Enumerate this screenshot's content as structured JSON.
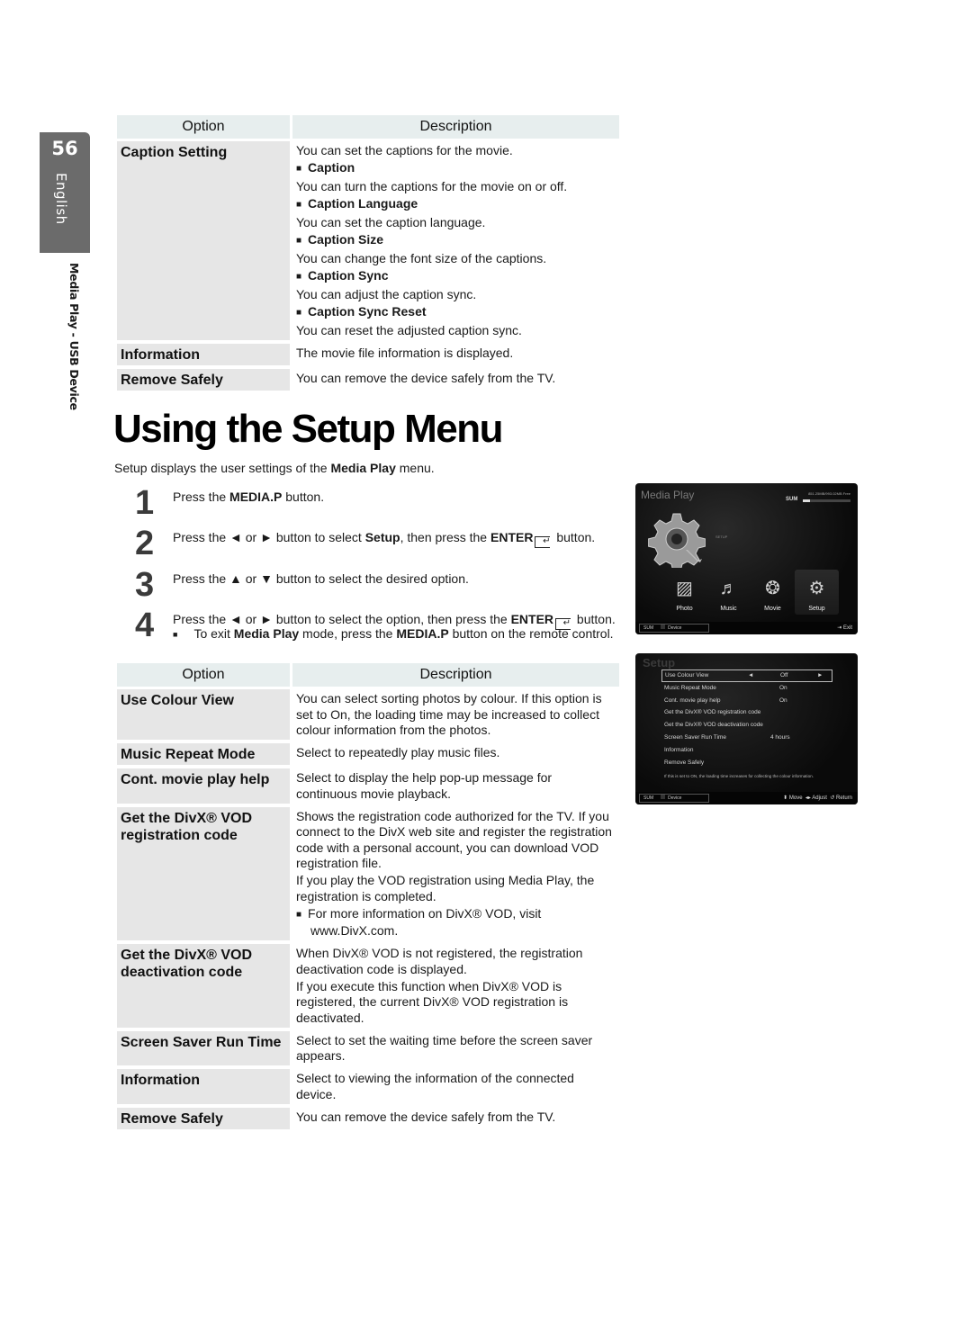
{
  "sidebar": {
    "page_number": "56",
    "language": "English",
    "section": "Media Play - USB Device"
  },
  "table1": {
    "header": {
      "option": "Option",
      "description": "Description"
    },
    "rows": [
      {
        "option": "Caption Setting",
        "lines": [
          {
            "type": "text",
            "text": "You can set the captions for the movie."
          },
          {
            "type": "sub",
            "text": "Caption"
          },
          {
            "type": "text",
            "text": "You can turn the captions for the movie on or off."
          },
          {
            "type": "sub",
            "text": "Caption Language"
          },
          {
            "type": "text",
            "text": "You can set the caption language."
          },
          {
            "type": "sub",
            "text": "Caption Size"
          },
          {
            "type": "text",
            "text": "You can change the font size of the captions."
          },
          {
            "type": "sub",
            "text": "Caption Sync"
          },
          {
            "type": "text",
            "text": "You can adjust the caption sync."
          },
          {
            "type": "sub",
            "text": "Caption Sync Reset"
          },
          {
            "type": "text",
            "text": "You can reset the adjusted caption sync."
          }
        ]
      },
      {
        "option": "Information",
        "lines": [
          {
            "type": "text",
            "text": "The movie file information is displayed."
          }
        ]
      },
      {
        "option": "Remove Safely",
        "lines": [
          {
            "type": "text",
            "text": "You can remove the device safely from the TV."
          }
        ]
      }
    ]
  },
  "heading": {
    "title": "Using the Setup Menu",
    "intro_pre": "Setup displays the user settings of the ",
    "intro_bold": "Media Play",
    "intro_post": " menu."
  },
  "steps": [
    {
      "num": "1",
      "parts": [
        [
          "t",
          "Press the "
        ],
        [
          "b",
          "MEDIA.P"
        ],
        [
          "t",
          " button."
        ]
      ]
    },
    {
      "num": "2",
      "parts": [
        [
          "t",
          "Press the ◄ or ► button to select "
        ],
        [
          "b",
          "Setup"
        ],
        [
          "t",
          ", then press the "
        ],
        [
          "b",
          "ENTER"
        ],
        [
          "i",
          ""
        ],
        [
          "t",
          " button."
        ]
      ]
    },
    {
      "num": "3",
      "parts": [
        [
          "t",
          "Press the ▲ or ▼ button to select the desired option."
        ]
      ]
    },
    {
      "num": "4",
      "parts": [
        [
          "t",
          "Press the ◄ or ► button to select the option, then press the "
        ],
        [
          "b",
          "ENTER"
        ],
        [
          "i",
          ""
        ],
        [
          "t",
          " button."
        ]
      ],
      "note": [
        [
          "t",
          "To exit "
        ],
        [
          "b",
          "Media Play"
        ],
        [
          "t",
          " mode, press the "
        ],
        [
          "b",
          "MEDIA.P"
        ],
        [
          "t",
          " button on the remote control."
        ]
      ]
    }
  ],
  "table2": {
    "header": {
      "option": "Option",
      "description": "Description"
    },
    "rows": [
      {
        "option": "Use Colour View",
        "lines": [
          {
            "type": "text",
            "text": "You can select sorting photos by colour. If this option is set to On, the loading time may be increased to collect colour information from the photos."
          }
        ]
      },
      {
        "option": "Music Repeat Mode",
        "lines": [
          {
            "type": "text",
            "text": "Select to repeatedly play music files."
          }
        ]
      },
      {
        "option": "Cont. movie play help",
        "lines": [
          {
            "type": "text",
            "text": "Select to display the help pop-up message for continuous movie playback."
          }
        ]
      },
      {
        "option": "Get the DivX® VOD registration code",
        "lines": [
          {
            "type": "text",
            "text": "Shows the registration code authorized for the TV. If you connect to the DivX web site and register the registration code with a personal account, you can download VOD registration file."
          },
          {
            "type": "text",
            "text": "If you play the VOD registration using Media Play, the registration is completed."
          },
          {
            "type": "note",
            "text": "For more information on DivX® VOD, visit www.DivX.com."
          }
        ]
      },
      {
        "option": "Get the DivX® VOD deactivation code",
        "lines": [
          {
            "type": "text",
            "text": "When DivX® VOD is not registered, the registration deactivation code is displayed."
          },
          {
            "type": "text",
            "text": "If you execute this function when DivX® VOD is registered, the current DivX® VOD registration is deactivated."
          }
        ]
      },
      {
        "option": "Screen Saver Run Time",
        "lines": [
          {
            "type": "text",
            "text": "Select to set the waiting time before the screen saver appears."
          }
        ]
      },
      {
        "option": "Information",
        "lines": [
          {
            "type": "text",
            "text": "Select to viewing the information of the connected device."
          }
        ]
      },
      {
        "option": "Remove Safely",
        "lines": [
          {
            "type": "text",
            "text": "You can remove the device safely from the TV."
          }
        ]
      }
    ]
  },
  "tv_media_play": {
    "title": "Media Play",
    "device": "SUM",
    "storage_text": "851.25MB/993.02MB Free",
    "storage_used_fraction": 0.15,
    "focus_label": "SETUP",
    "icons": [
      {
        "label": "Photo",
        "icon": "photo-icon",
        "glyph": "▨"
      },
      {
        "label": "Music",
        "icon": "music-note-icon",
        "glyph": "♬"
      },
      {
        "label": "Movie",
        "icon": "film-reel-icon",
        "glyph": "❂"
      },
      {
        "label": "Setup",
        "icon": "gear-icon",
        "glyph": "⚙",
        "selected": true
      }
    ],
    "bottom": {
      "device": "SUM",
      "device_label": "Device",
      "exit": "Exit"
    }
  },
  "tv_setup": {
    "title": "Setup",
    "items": [
      {
        "label": "Use Colour View",
        "value": "Off",
        "selected": true
      },
      {
        "label": "Music Repeat Mode",
        "value": "On"
      },
      {
        "label": "Cont. movie play help",
        "value": "On"
      },
      {
        "label": "Get the DivX® VOD registration code",
        "value": ""
      },
      {
        "label": "Get the DivX® VOD deactivation code",
        "value": ""
      },
      {
        "label": "Screen Saver Run Time",
        "value": "4 hours",
        "time": true
      },
      {
        "label": "Information",
        "value": ""
      },
      {
        "label": "Remove Safely",
        "value": ""
      }
    ],
    "help": "If this is set to ON, the loading time increases for collecting the colour information.",
    "bottom": {
      "device": "SUM",
      "device_label": "Device",
      "move": "Move",
      "adjust": "Adjust",
      "return": "Return"
    }
  }
}
